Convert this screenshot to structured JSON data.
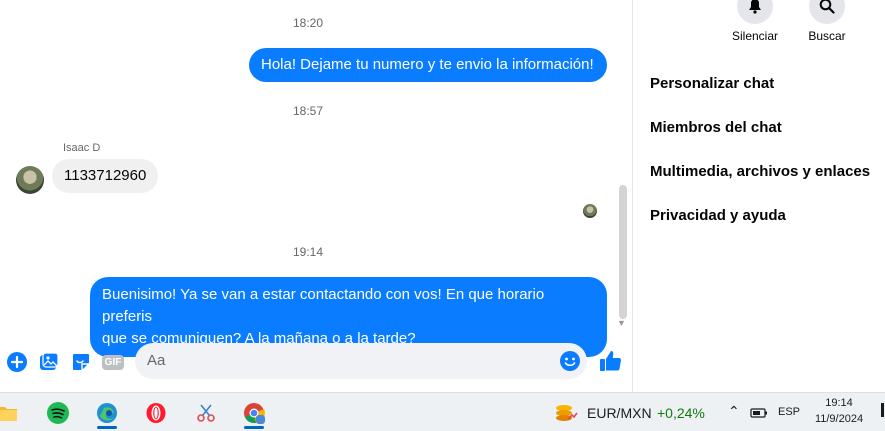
{
  "chat": {
    "time1": "18:20",
    "msg_out_1": "Hola! Dejame tu numero y te envio la información!",
    "time2": "18:57",
    "sender_name": "Isaac D",
    "msg_in_1": "1133712960",
    "time3": "19:14",
    "msg_out_2_line1": "Buenisimo! Ya se van a estar contactando con vos! En que horario preferis",
    "msg_out_2_line2": "que se comuniquen? A la mañana o a la tarde?"
  },
  "composer": {
    "placeholder": "Aa",
    "gif_label": "GIF"
  },
  "panel": {
    "mute_label": "Silenciar",
    "search_label": "Buscar",
    "items": [
      {
        "label": "Personalizar chat"
      },
      {
        "label": "Miembros del chat"
      },
      {
        "label": "Multimedia, archivos y enlaces"
      },
      {
        "label": "Privacidad y ayuda"
      }
    ]
  },
  "taskbar": {
    "currency_pair": "EUR/MXN",
    "currency_change": "+0,24%",
    "language": "ESP",
    "clock_time": "19:14",
    "clock_date": "11/9/2024"
  },
  "colors": {
    "accent": "#0a7cff",
    "positive": "#107c10"
  }
}
